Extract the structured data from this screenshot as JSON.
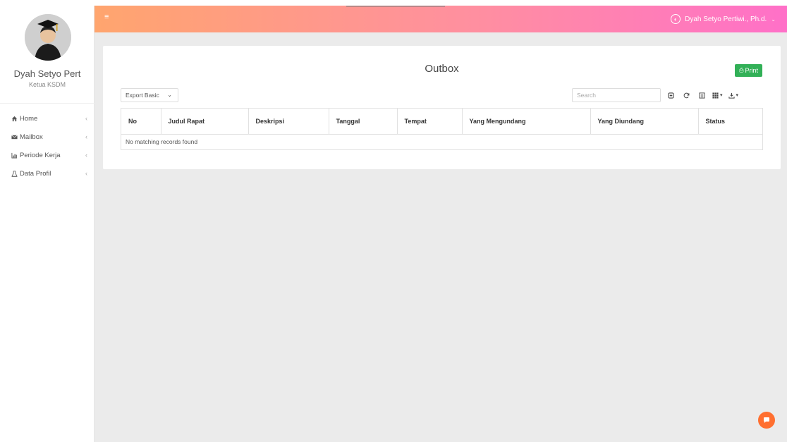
{
  "user": {
    "name": "Dyah Setyo Pert",
    "role": "Ketua KSDM",
    "full_name": "Dyah Setyo Pertiwi., Ph.d."
  },
  "sidebar": {
    "items": [
      {
        "label": "Home",
        "icon": "home-icon"
      },
      {
        "label": "Mailbox",
        "icon": "envelope-icon"
      },
      {
        "label": "Periode Kerja",
        "icon": "bar-chart-icon"
      },
      {
        "label": "Data Profil",
        "icon": "flask-icon"
      }
    ]
  },
  "page": {
    "title": "Outbox",
    "print_label": "Print"
  },
  "toolbar": {
    "export_value": "Export Basic",
    "search_placeholder": "Search"
  },
  "table": {
    "columns": [
      "No",
      "Judul Rapat",
      "Deskripsi",
      "Tanggal",
      "Tempat",
      "Yang Mengundang",
      "Yang Diundang",
      "Status"
    ],
    "empty_message": "No matching records found"
  },
  "colors": {
    "topbar_start": "#ffa56e",
    "topbar_end": "#ff70c8",
    "print_button": "#32b057",
    "chat_bubble": "#ff6f30"
  }
}
